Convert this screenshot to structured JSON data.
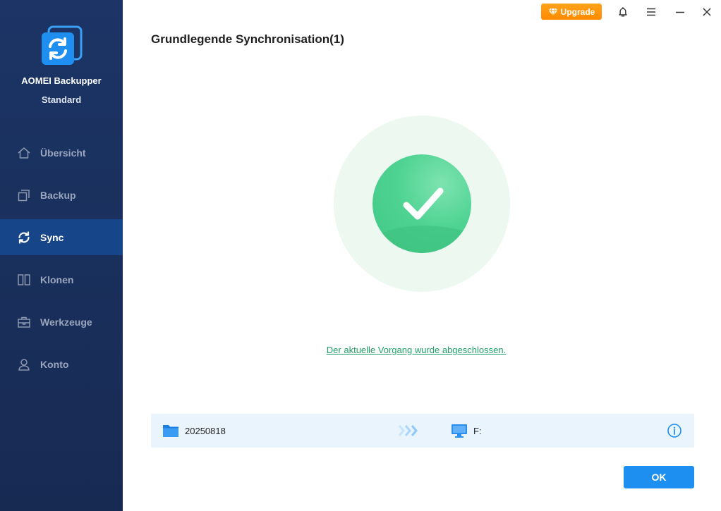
{
  "app": {
    "name": "AOMEI Backupper",
    "edition": "Standard"
  },
  "sidebar": {
    "items": [
      {
        "label": "Übersicht",
        "icon": "home-icon",
        "active": false
      },
      {
        "label": "Backup",
        "icon": "backup-icon",
        "active": false
      },
      {
        "label": "Sync",
        "icon": "sync-icon",
        "active": true
      },
      {
        "label": "Klonen",
        "icon": "clone-icon",
        "active": false
      },
      {
        "label": "Werkzeuge",
        "icon": "toolbox-icon",
        "active": false
      },
      {
        "label": "Konto",
        "icon": "user-icon",
        "active": false
      }
    ]
  },
  "topbar": {
    "upgrade_label": "Upgrade"
  },
  "main": {
    "title": "Grundlegende Synchronisation(1)",
    "status_message": "Der aktuelle Vorgang wurde abgeschlossen.",
    "sync_source": "20250818",
    "sync_destination": "F:",
    "ok_label": "OK"
  },
  "colors": {
    "sidebar_bg": "#1c3566",
    "sidebar_active": "#17458a",
    "upgrade": "#ff9500",
    "success": "#4fd393",
    "link": "#23a06a",
    "primary_button": "#1d8ff0"
  }
}
